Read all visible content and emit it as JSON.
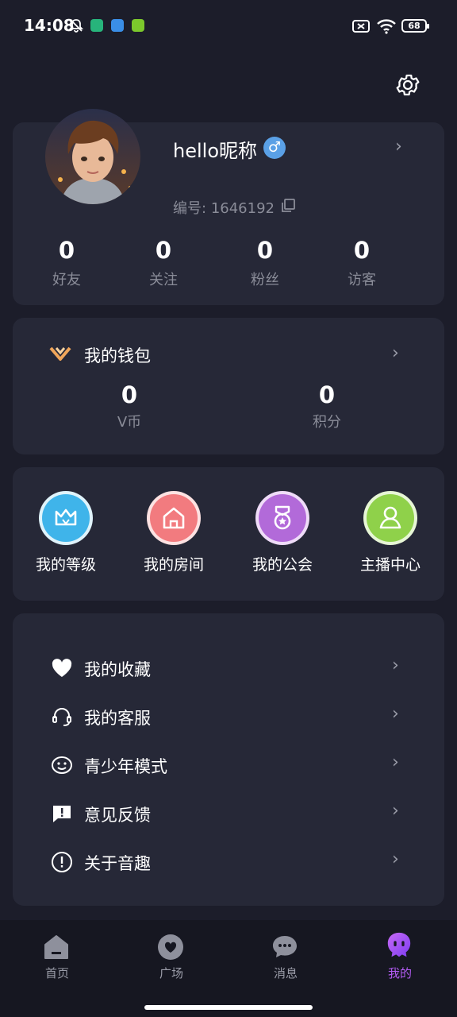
{
  "status_bar": {
    "time": "14:08",
    "battery": "68"
  },
  "profile": {
    "nickname": "hello昵称",
    "id_label": "编号:",
    "id_value": "1646192",
    "stats": [
      {
        "value": "0",
        "label": "好友"
      },
      {
        "value": "0",
        "label": "关注"
      },
      {
        "value": "0",
        "label": "粉丝"
      },
      {
        "value": "0",
        "label": "访客"
      }
    ]
  },
  "wallet": {
    "title": "我的钱包",
    "items": [
      {
        "value": "0",
        "label": "V币"
      },
      {
        "value": "0",
        "label": "积分"
      }
    ]
  },
  "tiles": [
    {
      "label": "我的等级",
      "icon": "crown-icon",
      "color": "#3fb4ea"
    },
    {
      "label": "我的房间",
      "icon": "house-icon",
      "color": "#f27b7f"
    },
    {
      "label": "我的公会",
      "icon": "guild-badge-icon",
      "color": "#b26ad9"
    },
    {
      "label": "主播中心",
      "icon": "streamer-person-icon",
      "color": "#8fd14a"
    }
  ],
  "menu": [
    {
      "label": "我的收藏",
      "icon": "heart-icon"
    },
    {
      "label": "我的客服",
      "icon": "headset-icon"
    },
    {
      "label": "青少年模式",
      "icon": "smile-face-icon"
    },
    {
      "label": "意见反馈",
      "icon": "feedback-icon"
    },
    {
      "label": "关于音趣",
      "icon": "info-icon"
    }
  ],
  "tabbar": [
    {
      "label": "首页",
      "icon": "home-icon"
    },
    {
      "label": "广场",
      "icon": "square-heart-icon"
    },
    {
      "label": "消息",
      "icon": "message-icon"
    },
    {
      "label": "我的",
      "icon": "mine-icon",
      "active": true
    }
  ],
  "colors": {
    "background": "#1c1d2a",
    "card": "#262837",
    "active_tab": "#b25cf2"
  }
}
